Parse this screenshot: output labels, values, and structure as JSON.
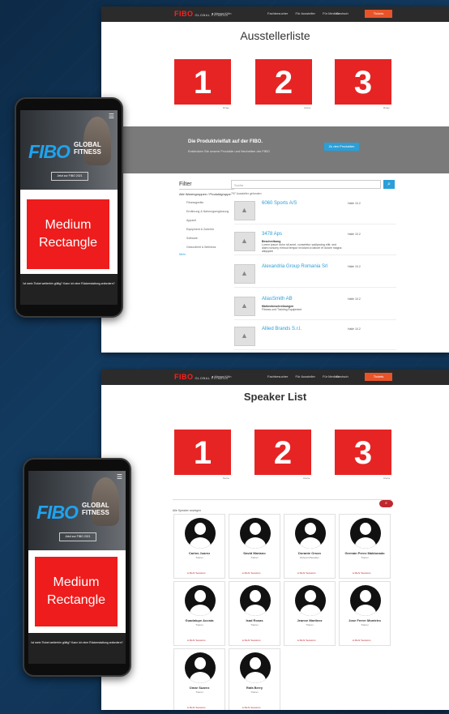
{
  "colors": {
    "accent": "#e62424",
    "brand_blue": "#2a9fd8",
    "nav": "#2b2b2b",
    "ticket": "#e8542a"
  },
  "nav": {
    "logo": "FIBO",
    "logo_sub": "GLOBAL FITNESS",
    "location": "Messe Köln",
    "links": [
      "Fachbesucher",
      "Für Aussteller",
      "Für Medien"
    ],
    "lang": "Deutsch",
    "ticket": "Tickets"
  },
  "exhibitors": {
    "title": "Ausstellerliste",
    "sponsors": [
      {
        "num": "1",
        "label": "Ringe"
      },
      {
        "num": "2",
        "label": "Arena"
      },
      {
        "num": "3",
        "label": "Ringe"
      }
    ],
    "banner": {
      "title": "Die Produktvielfalt auf der FIBO.",
      "subtitle": "Entdecken Sie unsere Produkte und Neuheiten der FIBO",
      "button": "Zu den Produkten"
    },
    "filter": {
      "title": "Filter",
      "category": "Alle Warengruppen / Produktgruppe",
      "options": [
        "Fitnessgeräte",
        "Ernährung & Nahrungsergänzung",
        "Apparel",
        "Equipment & Zubehör",
        "Software",
        "Gesundheit & Wellness"
      ],
      "more": "Mehr"
    },
    "search": {
      "placeholder": "Suche",
      "button": "⌕",
      "count": "797 Aussteller gefunden"
    },
    "list": [
      {
        "name": "6060 Sports A/S",
        "desc_title": "",
        "desc": "",
        "booth": "Halle 10.2"
      },
      {
        "name": "3478 Aps",
        "desc_title": "Beschreibung",
        "desc": "Lorem ipsum dolor sit amet, consetetur sadipscing elitr, sed diam nonumy eirmod tempor invidunt ut labore et dolore magna aliquyam",
        "booth": "Halle 10.2"
      },
      {
        "name": "Alexandria Group Romania Srl",
        "desc_title": "",
        "desc": "",
        "booth": "Halle 10.2"
      },
      {
        "name": "AliasSmith AB",
        "desc_title": "Markenbeschreibungen",
        "desc": "Fitness und Training Equipment",
        "booth": "Halle 10.2"
      },
      {
        "name": "Allied Brands S.r.l.",
        "desc_title": "",
        "desc": "",
        "booth": "Halle 10.2"
      }
    ]
  },
  "speakers": {
    "title": "Speaker List",
    "sponsors": [
      {
        "num": "1",
        "label": "Name"
      },
      {
        "num": "2",
        "label": "Arena"
      },
      {
        "num": "3",
        "label": "Arena"
      }
    ],
    "sort_label": "Alle Speaker anzeigen",
    "sort_button": "⌕",
    "link": "Mehr Sessions",
    "list": [
      {
        "name": "Carlos Juarez",
        "role": "Trainer"
      },
      {
        "name": "David Mariano",
        "role": "Trainer"
      },
      {
        "name": "Dorante Orson",
        "role": "Referent/Speaker"
      },
      {
        "name": "Germán Perez Maldonado",
        "role": "Trainer"
      },
      {
        "name": "Guadalupe Acosta",
        "role": "Trainer"
      },
      {
        "name": "Isad Rosas",
        "role": "Trainer"
      },
      {
        "name": "Jeanne Martinez",
        "role": "Trainer"
      },
      {
        "name": "Jose Ferrer Monteiro",
        "role": "Trainer"
      },
      {
        "name": "Omar Suarez",
        "role": "Trainer"
      },
      {
        "name": "Rafa Berry",
        "role": "Trainer"
      }
    ]
  },
  "mobile": {
    "logo": "FIBO",
    "logo_sub_1": "GLOBAL",
    "logo_sub_2": "FITNESS",
    "cta": "Jetzt zur FIBO 2021",
    "ad": "Medium Rectangle",
    "footer": "Ist mein Ticket weiterhin gültig? Kann ich eine Rückerstattung anfordern?"
  }
}
